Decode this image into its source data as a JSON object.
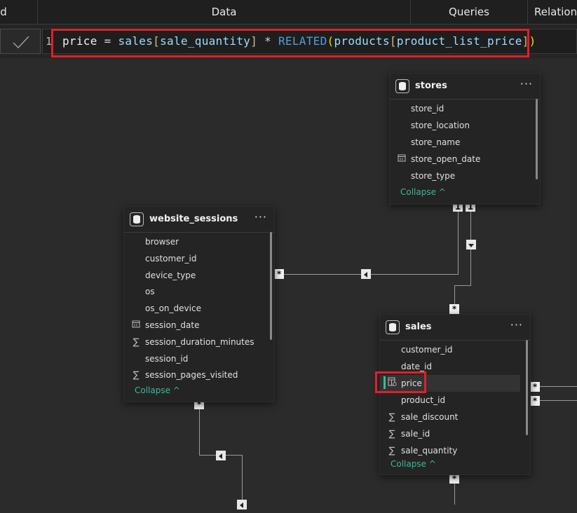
{
  "topbar": {
    "tab_left": "d",
    "tab_data": "Data",
    "tab_queries": "Queries",
    "tab_relations": "Relation"
  },
  "formula": {
    "line_number": "1",
    "tokens": [
      {
        "t": "price",
        "c": "tok-id"
      },
      {
        "t": " = ",
        "c": "tok-op"
      },
      {
        "t": "sales",
        "c": "tok-tbl"
      },
      {
        "t": "[",
        "c": "tok-br"
      },
      {
        "t": "sale_quantity",
        "c": "tok-col"
      },
      {
        "t": "]",
        "c": "tok-br"
      },
      {
        "t": " * ",
        "c": "tok-op"
      },
      {
        "t": "RELATED",
        "c": "tok-fn"
      },
      {
        "t": "(",
        "c": "tok-par"
      },
      {
        "t": "products",
        "c": "tok-tbl"
      },
      {
        "t": "[",
        "c": "tok-br"
      },
      {
        "t": "product_list_price",
        "c": "tok-col"
      },
      {
        "t": "]",
        "c": "tok-br"
      },
      {
        "t": ")",
        "c": "tok-par"
      }
    ]
  },
  "stores": {
    "title": "stores",
    "more": "···",
    "fields": [
      {
        "name": "store_id",
        "icon": ""
      },
      {
        "name": "store_location",
        "icon": ""
      },
      {
        "name": "store_name",
        "icon": ""
      },
      {
        "name": "store_open_date",
        "icon": "calendar-icon"
      },
      {
        "name": "store_type",
        "icon": ""
      }
    ],
    "collapse": "Collapse ^"
  },
  "website_sessions": {
    "title": "website_sessions",
    "more": "···",
    "fields": [
      {
        "name": "browser",
        "icon": ""
      },
      {
        "name": "customer_id",
        "icon": ""
      },
      {
        "name": "device_type",
        "icon": ""
      },
      {
        "name": "os",
        "icon": ""
      },
      {
        "name": "os_on_device",
        "icon": ""
      },
      {
        "name": "session_date",
        "icon": "calendar-icon"
      },
      {
        "name": "session_duration_minutes",
        "icon": "sigma-icon"
      },
      {
        "name": "session_id",
        "icon": ""
      },
      {
        "name": "session_pages_visited",
        "icon": "sigma-icon"
      }
    ],
    "collapse": "Collapse ^"
  },
  "sales": {
    "title": "sales",
    "more": "···",
    "fields": [
      {
        "name": "customer_id",
        "icon": ""
      },
      {
        "name": "date_id",
        "icon": ""
      },
      {
        "name": "price",
        "icon": "calculated-column-icon"
      },
      {
        "name": "product_id",
        "icon": ""
      },
      {
        "name": "sale_discount",
        "icon": "sigma-icon"
      },
      {
        "name": "sale_id",
        "icon": "sigma-icon"
      },
      {
        "name": "sale_quantity",
        "icon": "sigma-icon"
      }
    ],
    "collapse": "Collapse ^"
  },
  "markers": {
    "one": "1",
    "many": "*"
  },
  "colors": {
    "highlight": "#e0202a",
    "accent": "#3ab99a"
  }
}
